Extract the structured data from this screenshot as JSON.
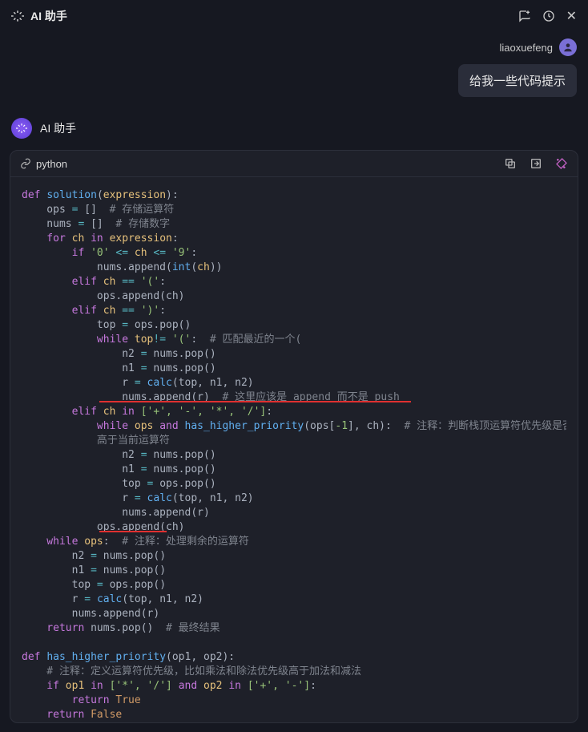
{
  "titlebar": {
    "title": "AI 助手"
  },
  "user": {
    "name": "liaoxuefeng"
  },
  "user_message": "给我一些代码提示",
  "assistant": {
    "name": "AI 助手"
  },
  "code": {
    "language": "python"
  },
  "tokens": {
    "def_solution": "def ",
    "solution": "solution",
    "lparen": "(",
    "expression": "expression",
    "rparen_colon": "):",
    "ops_eq": "    ops ",
    "eq": "= ",
    "brackets": "[]",
    "comment_ops": "  # 存储运算符",
    "nums_eq": "    nums ",
    "comment_nums": "  # 存储数字",
    "for": "    for ",
    "ch": "ch",
    "in": " in ",
    "colon": ":",
    "if": "        if ",
    "s0": "'0'",
    "lte": " <= ",
    "s9": "'9'",
    "nums_append_intch": "            nums.append(",
    "int": "int",
    "openp": "(",
    "closep_closep": "))",
    "elif": "        elif ",
    "eqeq": " == ",
    "slp": "'('",
    "srp": "')'",
    "ops_append_ch": "            ops.append(ch)",
    "top_eq_pop": "            top ",
    "ops_pop": "ops.pop()",
    "while": "            while ",
    "top": "top",
    "neq": "!= ",
    "comment_match": "  # 匹配最近的一个(",
    "n2_eq": "                n2 ",
    "nums_pop": "nums.pop()",
    "n1_eq": "                n1 ",
    "r_eq": "                r ",
    "calc": "calc",
    "calc_args": "(top, n1, n2)",
    "nums_append_r": "                nums.append(r)",
    "comment_append": "  # 这里应该是 append 而不是 push",
    "in_ops_list": " in ",
    "ops_list": "['+', '-', '*', '/']",
    "while2": "            while ",
    "ops_id": "ops",
    "and": " and ",
    "has_higher": "has_higher_priority",
    "hhp_args": "(ops[",
    "neg1": "-1",
    "hhp_args2": "], ch):",
    "comment_prio": "  # 注释：判断栈顶运算符优先级是否",
    "comment_prio2": "            高于当前运算符",
    "top_eq_pop2": "                top ",
    "nums_append_r2": "                nums.append(r)",
    "ops_append_ch2": "            ops.append(ch)",
    "while_ops": "    while ",
    "comment_remain": "  # 注释：处理剩余的运算符",
    "return": "    return ",
    "nums_pop_call": "nums.pop()",
    "comment_final": "  # 最终结果",
    "def_hhp": "def ",
    "hhp_name": "has_higher_priority",
    "hhp_params": "(op1, op2):",
    "comment_hhp": "    # 注释：定义运算符优先级，比如乘法和除法优先级高于加法和减法",
    "if2": "    if ",
    "op1": "op1",
    "mul_div": "['*', '/']",
    "op2": "op2",
    "add_sub": "['+', '-']",
    "return_true": "        return ",
    "true": "True",
    "return_false": "    return ",
    "false": "False",
    "n2_eq_s": "        n2 ",
    "n1_eq_s": "        n1 ",
    "top_eq_s": "        top ",
    "r_eq_s": "        r ",
    "nums_append_r_s": "        nums.append(r)"
  }
}
